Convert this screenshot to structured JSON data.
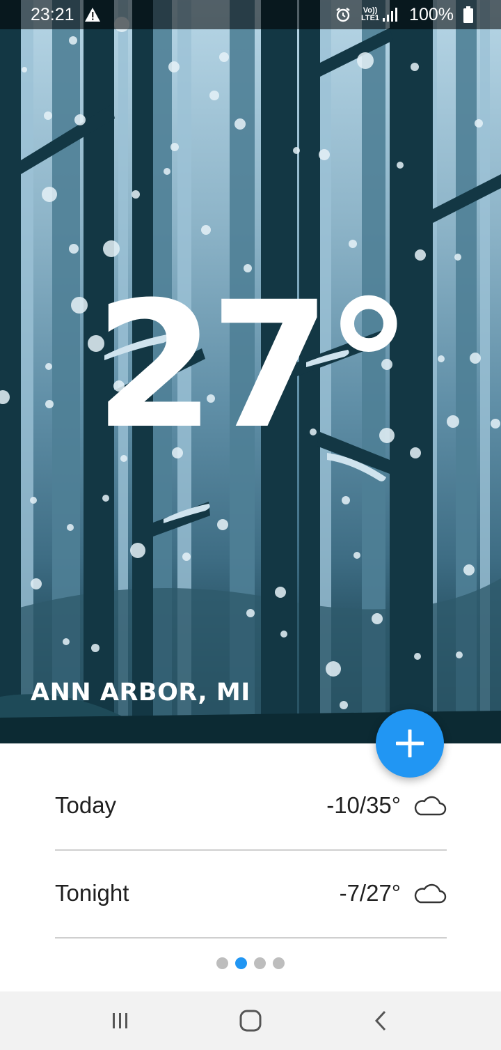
{
  "status_bar": {
    "time": "23:21",
    "warning_icon": "warning-icon",
    "alarm_icon": "alarm-icon",
    "network": "Vo)) LTE1",
    "battery": "100%"
  },
  "weather": {
    "temperature": "27°",
    "city": "ANN ARBOR, MI"
  },
  "fab": {
    "icon": "plus-icon"
  },
  "forecast": [
    {
      "label": "Today",
      "value": "-10/35°",
      "icon": "cloud-icon"
    },
    {
      "label": "Tonight",
      "value": "-7/27°",
      "icon": "cloud-icon"
    }
  ],
  "pager": {
    "count": 4,
    "active_index": 1
  },
  "nav": {
    "recents_icon": "recents-icon",
    "home_icon": "home-icon",
    "back_icon": "back-icon"
  },
  "colors": {
    "accent": "#2196f3",
    "hero_dark": "#0f2f3a"
  }
}
